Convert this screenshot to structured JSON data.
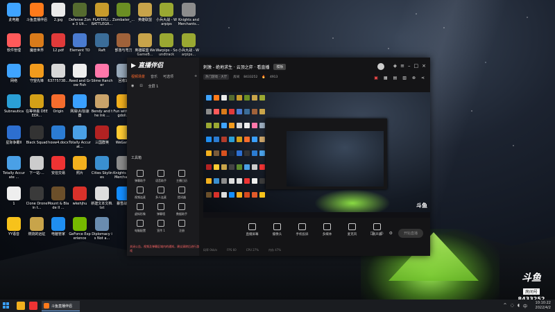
{
  "desktop": {
    "icons": [
      {
        "label": "此电脑",
        "color": "#3fa4ff"
      },
      {
        "label": "斗鱼直播伴侣",
        "color": "#ff7a1a"
      },
      {
        "label": "2.jpg",
        "color": "#eaeaea"
      },
      {
        "label": "Defense Zone 3 Ult...",
        "color": "#556b2f"
      },
      {
        "label": "PLAYERU... BATTLEGR...",
        "color": "#c79b2c"
      },
      {
        "label": "Zombater_...",
        "color": "#6b8e23"
      },
      {
        "label": "英雄联盟",
        "color": "#c8a44a"
      },
      {
        "label": "小兵大战 - Warpips",
        "color": "#9aa832"
      },
      {
        "label": "Knights and Merchants...",
        "color": "#8c8c8c"
      },
      {
        "label": "软件管理",
        "color": "#ff5a5a"
      },
      {
        "label": "魔兽世界",
        "color": "#d97b1a"
      },
      {
        "label": "12.pdf",
        "color": "#e03a3a"
      },
      {
        "label": "Element TD 2",
        "color": "#4a7bd0"
      },
      {
        "label": "Raft",
        "color": "#3b6d99"
      },
      {
        "label": "部落与弯刀",
        "color": "#a0623a"
      },
      {
        "label": "英雄联盟 WeGameB...",
        "color": "#c8a44a"
      },
      {
        "label": "Warpips - Soundtrack",
        "color": "#9aa832"
      },
      {
        "label": "小兵大战 - Warpips...",
        "color": "#9aa832"
      },
      {
        "label": "网络",
        "color": "#3fa4ff"
      },
      {
        "label": "守望先锋",
        "color": "#f29b1d"
      },
      {
        "label": "6377573B...",
        "color": "#d8d8d8"
      },
      {
        "label": "Reed and Grow Fish",
        "color": "#eeeeee"
      },
      {
        "label": "Slime Rancher",
        "color": "#ff77aa"
      },
      {
        "label": "回收站",
        "color": "#9ab"
      },
      {
        "label": "腾讯QQ",
        "color": "#1f8ef1"
      },
      {
        "label": "新建 Microsoft ...",
        "color": "#2b7cd3"
      },
      {
        "label": "Forts",
        "color": "#b23b2b"
      },
      {
        "label": "Subnautica",
        "color": "#2a9fd6"
      },
      {
        "label": "在等待最 DEEEER...",
        "color": "#d4a017"
      },
      {
        "label": "Origin",
        "color": "#f56c2d"
      },
      {
        "label": "网易UU加速器",
        "color": "#3aa0ff"
      },
      {
        "label": "Bendy and the Ink ...",
        "color": "#c9a36a"
      },
      {
        "label": "Fun with Ragdoll...",
        "color": "#f2b01e"
      },
      {
        "label": "They Are Billions",
        "color": "#7a5b3a"
      },
      {
        "label": "海妖 Firewatch",
        "color": "#d8521f"
      },
      {
        "label": "Steam",
        "color": "#1b2838"
      },
      {
        "label": "星际争霸II",
        "color": "#2d6fd0"
      },
      {
        "label": "Black Squad",
        "color": "#333333"
      },
      {
        "label": "hosw4.docx",
        "color": "#2b7cd3"
      },
      {
        "label": "Totally Accurat...",
        "color": "#4aa0e6"
      },
      {
        "label": "三国群英",
        "color": "#b22222"
      },
      {
        "label": "WeGame",
        "color": "#ffcc33"
      },
      {
        "label": "英雄联盟 WeGameB...",
        "color": "#c8a44a"
      },
      {
        "label": "Boris and the Dark ...",
        "color": "#444444"
      },
      {
        "label": "Grounded",
        "color": "#5c8a2e"
      },
      {
        "label": "Totally Accurate ...",
        "color": "#4aa0e6"
      },
      {
        "label": "下一站-...",
        "color": "#cccccc"
      },
      {
        "label": "安信交易",
        "color": "#e33"
      },
      {
        "label": "照片",
        "color": "#f2b01e"
      },
      {
        "label": "Cities Skylines",
        "color": "#3a8fd0"
      },
      {
        "label": "Knights and Merchants",
        "color": "#8c8c8c"
      },
      {
        "label": "webwaget...",
        "color": "#dddddd"
      },
      {
        "label": "文件类型.txt",
        "color": "#dddddd"
      },
      {
        "label": "安信行情",
        "color": "#e33"
      },
      {
        "label": "1",
        "color": "#eeeeee"
      },
      {
        "label": "Clone Drone in t...",
        "color": "#3a3a3a"
      },
      {
        "label": "Mount & Blade II ...",
        "color": "#6b4f2a"
      },
      {
        "label": "wkehjhu",
        "color": "#d9312a"
      },
      {
        "label": "新建文本文档.txt",
        "color": "#dddddd"
      },
      {
        "label": "暴雪战网",
        "color": "#148eff"
      },
      {
        "label": "文件管理器",
        "color": "#f2b01e"
      },
      {
        "label": "DDraceN...",
        "color": "#d64a1f"
      },
      {
        "label": "Overcook... 2",
        "color": "#e05a2a"
      },
      {
        "label": "YY语音",
        "color": "#f7c21b"
      },
      {
        "label": "燃烧的远征",
        "color": "#c8a44a"
      },
      {
        "label": "电脑管家",
        "color": "#1f8ef1"
      },
      {
        "label": "GeForce Experience",
        "color": "#76b900"
      },
      {
        "label": "Diplomacy is Not a...",
        "color": "#6a8caf"
      }
    ]
  },
  "app": {
    "logo_text": "直播伴侣",
    "side_tabs": [
      "视频场景",
      "音乐",
      "可选项"
    ],
    "scene": {
      "name": "全屏 1"
    },
    "tools_title": "工具箱",
    "tools": [
      {
        "label": "弹幕助手"
      },
      {
        "label": "语音助手"
      },
      {
        "label": "主播日历"
      },
      {
        "label": "视频连麦"
      },
      {
        "label": "多人连麦"
      },
      {
        "label": "提词器"
      },
      {
        "label": "虚拟形象"
      },
      {
        "label": "弹幕墙"
      },
      {
        "label": "数据助手"
      },
      {
        "label": "电脑配置"
      },
      {
        "label": "宣传 1"
      },
      {
        "label": "注册"
      }
    ],
    "side_alert": "关闭公告，视频及弹幕区域内的通知，建议清除后进行游戏",
    "title": "刺激 - 绝地求生 · 云顶之弈 · 看直播",
    "title_badge": "模板",
    "sub": {
      "category": "热门游戏 · 大厅",
      "room_label": "房间",
      "room": "8433252",
      "hot": "4913"
    },
    "controls": [
      {
        "label": "直播屏幕"
      },
      {
        "label": "摄像头"
      },
      {
        "label": "手机投屏"
      },
      {
        "label": "多媒体"
      },
      {
        "label": "麦克风"
      },
      {
        "label": "扬声器"
      }
    ],
    "live_button": "开始直播",
    "status": [
      "码率 0kb/s",
      "FPS 60",
      "CPU 27%",
      "内存 47%"
    ],
    "preview_watermark": "斗鱼"
  },
  "watermark": {
    "brand": "斗鱼",
    "room_label": "房间号",
    "room": "8433252"
  },
  "taskbar": {
    "app_label": "斗鱼直播伴侣",
    "time": "10:10:22",
    "date": "2022/4/2",
    "ime": "中"
  }
}
